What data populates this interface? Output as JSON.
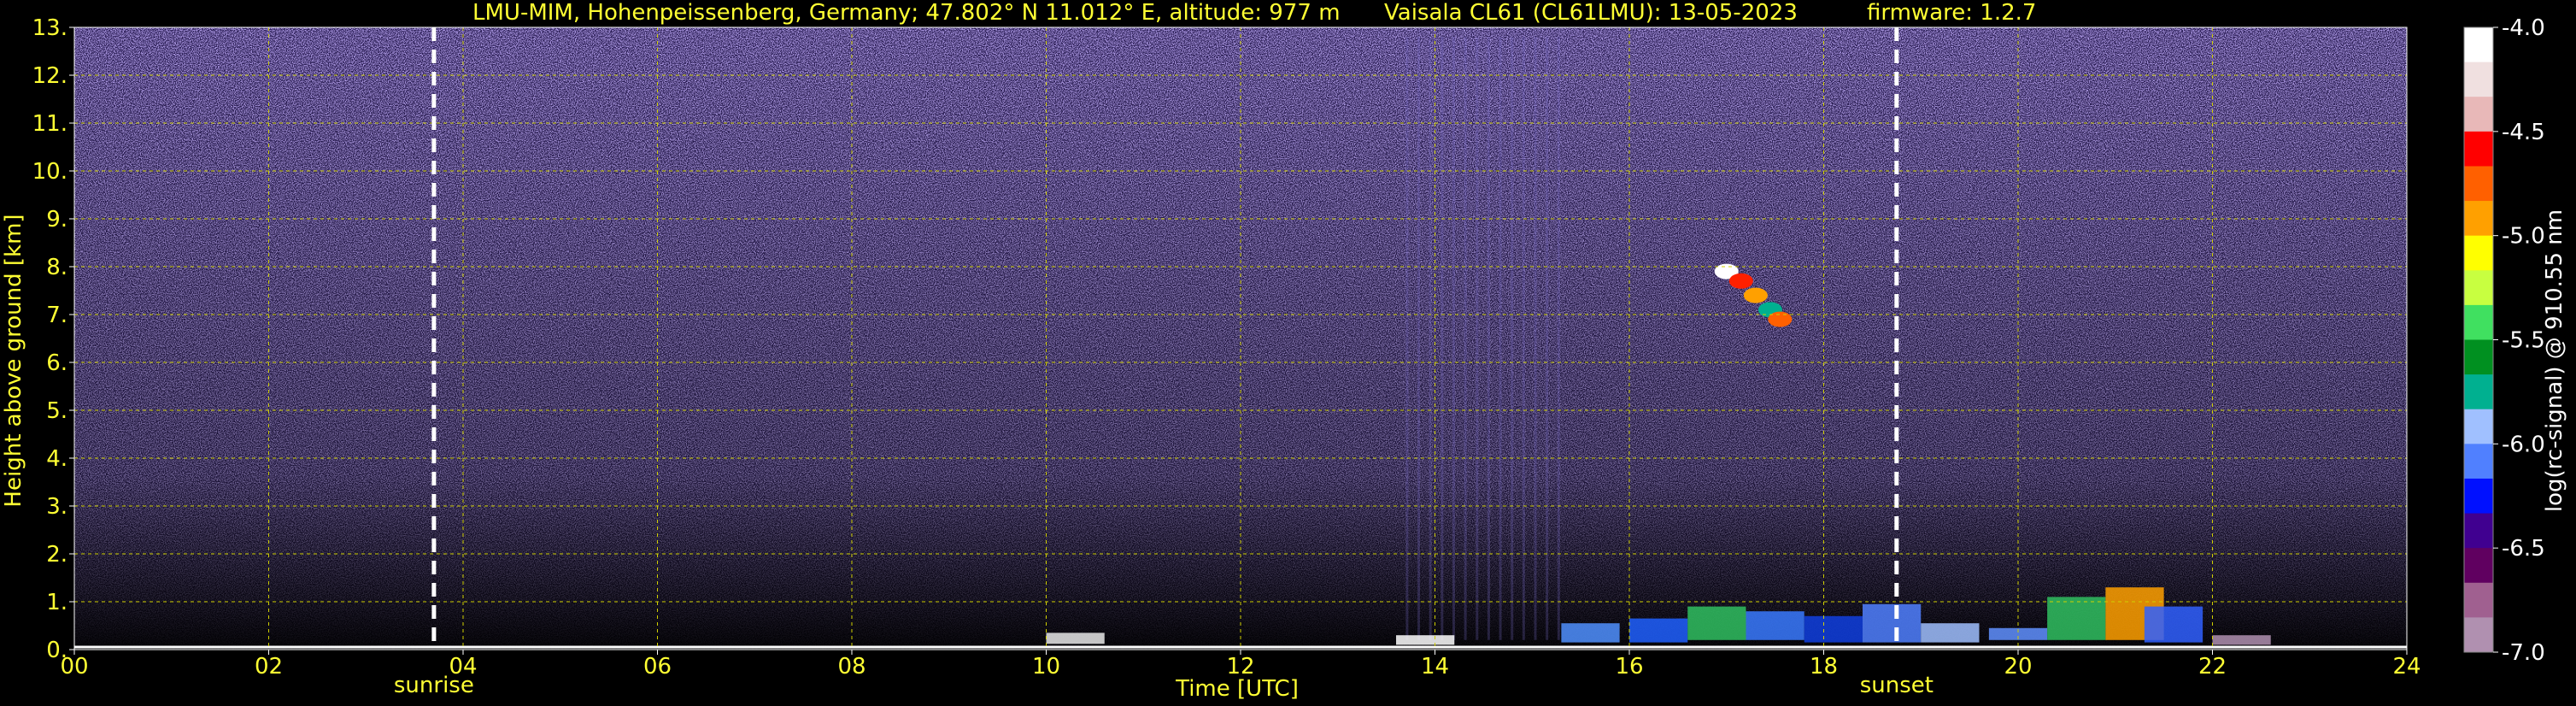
{
  "header": {
    "site": "LMU-MIM, Hohenpeissenberg, Germany; 47.802° N 11.012° E, altitude: 977 m",
    "instrument": "Vaisala CL61 (CL61LMU): 13-05-2023",
    "firmware": "firmware: 1.2.7"
  },
  "chart_data": {
    "type": "heatmap",
    "xlabel": "Time [UTC]",
    "ylabel": "Height above ground [km]",
    "colorbar_label": "log(rc-signal) @ 910.55 nm",
    "xlim": [
      0,
      24
    ],
    "ylim": [
      0,
      13
    ],
    "x_ticks": [
      "00",
      "02",
      "04",
      "06",
      "08",
      "10",
      "12",
      "14",
      "16",
      "18",
      "20",
      "22",
      "24"
    ],
    "x_tick_values": [
      0,
      2,
      4,
      6,
      8,
      10,
      12,
      14,
      16,
      18,
      20,
      22,
      24
    ],
    "y_ticks": [
      "0.",
      "1.",
      "2.",
      "3.",
      "4.",
      "5.",
      "6.",
      "7.",
      "8.",
      "9.",
      "10.",
      "11.",
      "12.",
      "13."
    ],
    "y_tick_values": [
      0,
      1,
      2,
      3,
      4,
      5,
      6,
      7,
      8,
      9,
      10,
      11,
      12,
      13
    ],
    "colorbar_ticks": [
      "-4.0",
      "-4.5",
      "-5.0",
      "-5.5",
      "-6.0",
      "-6.5",
      "-7.0"
    ],
    "colorbar_values": [
      -4.0,
      -4.5,
      -5.0,
      -5.5,
      -6.0,
      -6.5,
      -7.0
    ],
    "colorbar_range": [
      -7.0,
      -4.0
    ],
    "grid": true,
    "events": [
      {
        "label": "sunrise",
        "time": 3.7
      },
      {
        "label": "sunset",
        "time": 18.75
      }
    ],
    "colormap": [
      "#ffffff",
      "#f0e0e0",
      "#e8b8b8",
      "#ff0000",
      "#ff6000",
      "#ffa000",
      "#ffff00",
      "#c8ff40",
      "#40e060",
      "#009020",
      "#00b090",
      "#a0c0ff",
      "#5080ff",
      "#0010ff",
      "#400090",
      "#600060",
      "#a06090",
      "#b090b0"
    ],
    "colors": {
      "background": "#000000",
      "grid": "#d0d000",
      "text": "#ffff33",
      "noise": "#6a4fbf"
    }
  }
}
